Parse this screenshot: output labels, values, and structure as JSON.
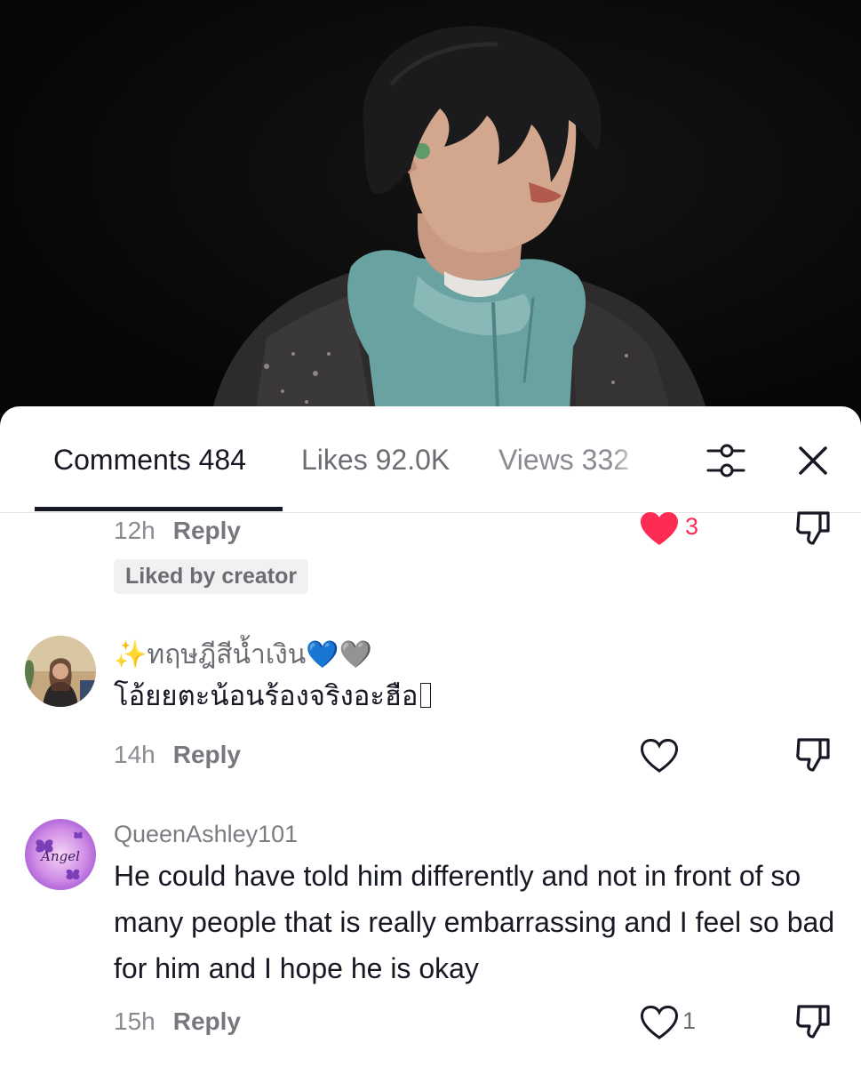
{
  "tabs": {
    "comments": {
      "label": "Comments",
      "count": "484"
    },
    "likes": {
      "label": "Likes",
      "count": "92.0K"
    },
    "views": {
      "label": "Views",
      "count": "332"
    }
  },
  "icons": {
    "filter": "sliders-icon",
    "close": "close-icon",
    "like": "heart-icon",
    "dislike": "thumbs-down-icon"
  },
  "colors": {
    "liked_heart": "#fe2c55",
    "text": "#161823",
    "secondary": "#8a8b91"
  },
  "comments": [
    {
      "time": "12h",
      "reply_label": "Reply",
      "likes": "3",
      "liked": true,
      "badge": "Liked by creator"
    },
    {
      "username": "✨ทฤษฎีสีน้ำเงิน💙🩶",
      "text": "โอ้ยยตะน้อนร้องจริงอะฮือ",
      "time": "14h",
      "reply_label": "Reply",
      "likes": "",
      "liked": false
    },
    {
      "username": "QueenAshley101",
      "avatar_text": "Angel",
      "text": "He could have told him differently and not in front of so many people that is really embarrassing and I feel so bad for him and I hope he is okay",
      "time": "15h",
      "reply_label": "Reply",
      "likes": "1",
      "liked": false
    }
  ]
}
